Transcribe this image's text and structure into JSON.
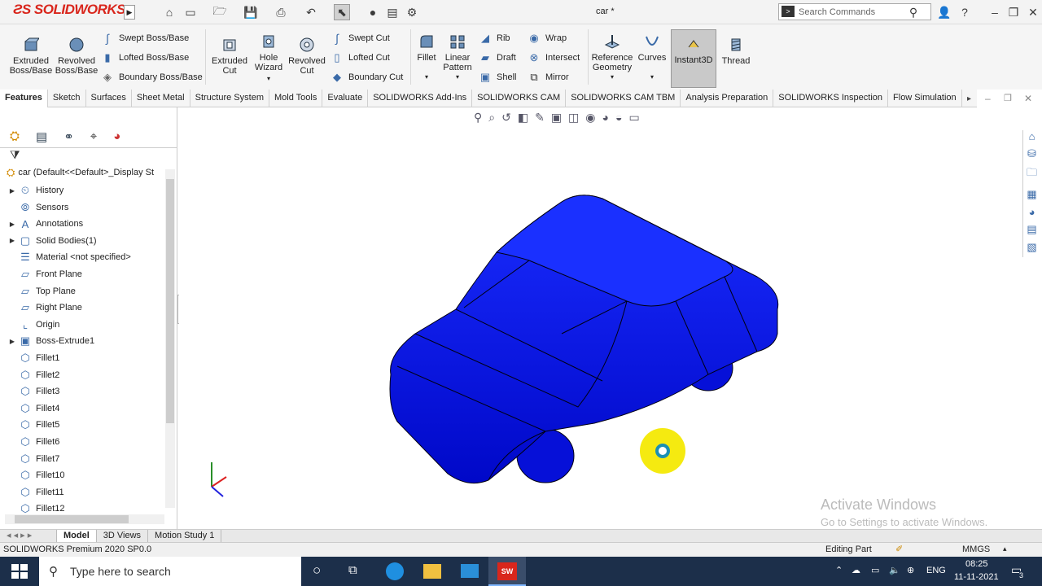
{
  "app": {
    "brand": "SOLIDWORKS",
    "doc_title": "car *",
    "search_placeholder": "Search Commands"
  },
  "ribbon": {
    "extruded_boss": "Extruded Boss/Base",
    "revolved_boss": "Revolved Boss/Base",
    "swept_boss": "Swept Boss/Base",
    "lofted_boss": "Lofted Boss/Base",
    "boundary_boss": "Boundary Boss/Base",
    "extruded_cut": "Extruded Cut",
    "hole_wizard": "Hole Wizard",
    "revolved_cut": "Revolved Cut",
    "swept_cut": "Swept Cut",
    "lofted_cut": "Lofted Cut",
    "boundary_cut": "Boundary Cut",
    "fillet": "Fillet",
    "linear_pattern": "Linear Pattern",
    "rib": "Rib",
    "draft": "Draft",
    "shell": "Shell",
    "wrap": "Wrap",
    "intersect": "Intersect",
    "mirror": "Mirror",
    "reference_geometry": "Reference Geometry",
    "curves": "Curves",
    "instant3d": "Instant3D",
    "thread": "Thread"
  },
  "tabs": [
    "Features",
    "Sketch",
    "Surfaces",
    "Sheet Metal",
    "Structure System",
    "Mold Tools",
    "Evaluate",
    "SOLIDWORKS Add-Ins",
    "SOLIDWORKS CAM",
    "SOLIDWORKS CAM TBM",
    "Analysis Preparation",
    "SOLIDWORKS Inspection",
    "Flow Simulation"
  ],
  "tree": {
    "root": "car  (Default<<Default>_Display St",
    "items": [
      "History",
      "Sensors",
      "Annotations",
      "Solid Bodies(1)",
      "Material <not specified>",
      "Front Plane",
      "Top Plane",
      "Right Plane",
      "Origin",
      "Boss-Extrude1",
      "Fillet1",
      "Fillet2",
      "Fillet3",
      "Fillet4",
      "Fillet5",
      "Fillet6",
      "Fillet7",
      "Fillet10",
      "Fillet11",
      "Fillet12"
    ]
  },
  "bottom_tabs": [
    "Model",
    "3D Views",
    "Motion Study 1"
  ],
  "status": {
    "left": "SOLIDWORKS Premium 2020 SP0.0",
    "mode": "Editing Part",
    "units": "MMGS"
  },
  "watermark": {
    "line1": "Activate Windows",
    "line2": "Go to Settings to activate Windows."
  },
  "taskbar": {
    "search": "Type here to search",
    "lang": "ENG",
    "time": "08:25",
    "date": "11-11-2021",
    "notifications": "3"
  },
  "colors": {
    "model": "#0a12f0",
    "accent": "#d9261c",
    "taskbar": "#1c2f4a"
  }
}
